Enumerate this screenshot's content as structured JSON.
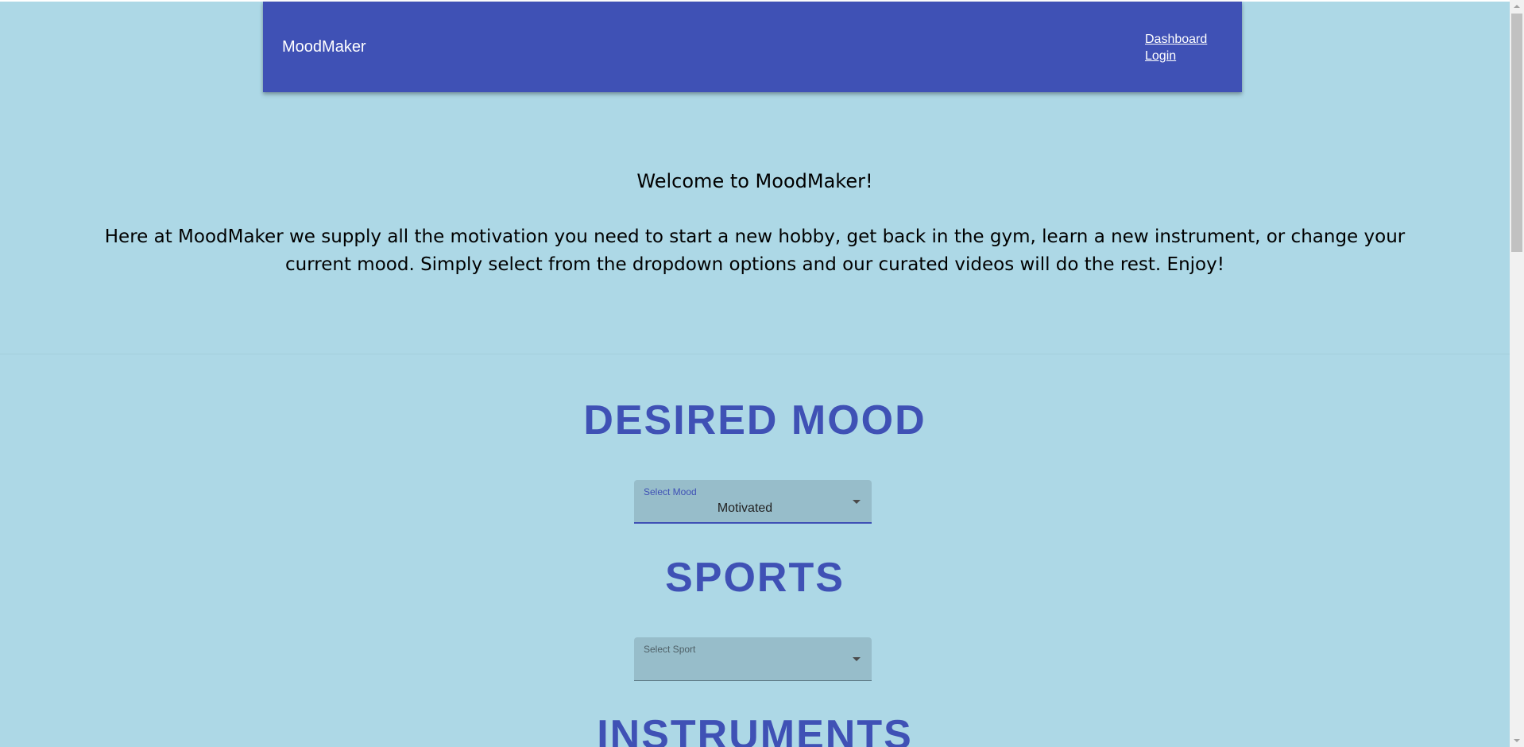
{
  "header": {
    "brand": "MoodMaker",
    "links": [
      "Dashboard",
      "Login"
    ]
  },
  "hero": {
    "welcome": "Welcome to MoodMaker!",
    "intro": "Here at MoodMaker we supply all the motivation you need to start a new hobby, get back in the gym, learn a new instrument, or change your current mood. Simply select from the dropdown options and our curated videos will do the rest. Enjoy!"
  },
  "sections": {
    "mood": {
      "heading": "DESIRED MOOD",
      "select_label": "Select Mood",
      "selected_value": "Motivated"
    },
    "sports": {
      "heading": "SPORTS",
      "select_label": "Select Sport",
      "selected_value": ""
    },
    "instruments": {
      "heading": "INSTRUMENTS"
    }
  },
  "icons": {
    "dropdown": "caret-down-icon"
  },
  "colors": {
    "page_background": "#add8e6",
    "navbar": "#3f51b5",
    "heading": "#3f51b5",
    "select_fill": "#97bdca"
  }
}
